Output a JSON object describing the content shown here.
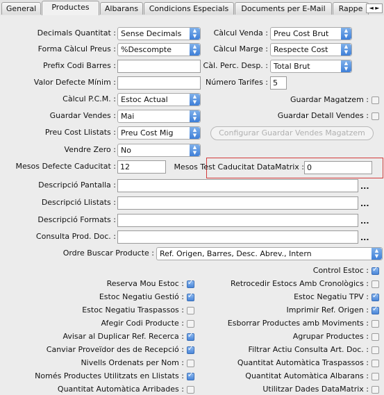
{
  "tabs": [
    "General",
    "Productes",
    "Albarans",
    "Condicions Especials",
    "Documents per E-Mail",
    "Rappe"
  ],
  "tab_scroll_arrows": "◄ ►",
  "form": {
    "decimals_quantitat": {
      "label": "Decimals Quantitat :",
      "value": "Sense Decimals"
    },
    "forma_calcul_preus": {
      "label": "Forma Càlcul Preus :",
      "value": "%Descompte"
    },
    "prefix_codi_barres": {
      "label": "Prefix Codi Barres :",
      "value": ""
    },
    "valor_defecte_minim": {
      "label": "Valor Defecte Mínim :",
      "value": ""
    },
    "calcul_pcm": {
      "label": "Càlcul P.C.M. :",
      "value": "Estoc Actual"
    },
    "guardar_vendes": {
      "label": "Guardar Vendes :",
      "value": "Mai"
    },
    "preu_cost_llistats": {
      "label": "Preu Cost Llistats :",
      "value": "Preu Cost Mig"
    },
    "vendre_zero": {
      "label": "Vendre Zero :",
      "value": "No"
    },
    "mesos_defecte_caducitat": {
      "label": "Mesos Defecte Caducitat :",
      "value": "12"
    },
    "calcul_venda": {
      "label": "Càlcul Venda :",
      "value": "Preu Cost Brut"
    },
    "calcul_marge": {
      "label": "Càlcul Marge :",
      "value": "Respecte Cost"
    },
    "cal_perc_desp": {
      "label": "Càl. Perc. Desp. :",
      "value": "Total Brut"
    },
    "numero_tarifes": {
      "label": "Número Tarifes :",
      "value": "5"
    },
    "guardar_magatzem": {
      "label": "Guardar Magatzem :",
      "checked": false
    },
    "guardar_detall_vendes": {
      "label": "Guardar Detall Vendes :",
      "checked": false
    },
    "configurar_button": "Configurar Guardar Vendes Magatzem",
    "mesos_test_caducitat": {
      "label": "Mesos Test Caducitat DataMatrix :",
      "value": "0"
    },
    "descripcio_pantalla": {
      "label": "Descripció Pantalla :",
      "value": ""
    },
    "descripcio_llistats": {
      "label": "Descripció Llistats :",
      "value": ""
    },
    "descripcio_formats": {
      "label": "Descripció Formats :",
      "value": ""
    },
    "consulta_prod_doc": {
      "label": "Consulta Prod. Doc. :",
      "value": ""
    },
    "ellipsis": "...",
    "ordre_buscar": {
      "label": "Ordre Buscar Producte :",
      "value": "Ref. Origen, Barres, Desc. Abrev., Intern"
    }
  },
  "checks_left": [
    {
      "label": "Reserva Mou Estoc :",
      "checked": true
    },
    {
      "label": "Estoc Negatiu Gestió :",
      "checked": true
    },
    {
      "label": "Estoc Negatiu Traspassos :",
      "checked": false
    },
    {
      "label": "Afegir Codi Producte :",
      "checked": false
    },
    {
      "label": "Avisar al Duplicar Ref. Recerca :",
      "checked": true
    },
    {
      "label": "Canviar Proveïdor des de Recepció :",
      "checked": true
    },
    {
      "label": "Nivells Ordenats per Nom :",
      "checked": false
    },
    {
      "label": "Només Productes Utilitzats en Llistats :",
      "checked": true
    },
    {
      "label": "Quantitat Automàtica Arribades :",
      "checked": false
    }
  ],
  "checks_right": [
    {
      "label": "Control Estoc :",
      "checked": true
    },
    {
      "label": "Retrocedir Estocs Amb Cronològics :",
      "checked": false
    },
    {
      "label": "Estoc Negatiu TPV :",
      "checked": true
    },
    {
      "label": "Imprimir Ref. Origen :",
      "checked": true
    },
    {
      "label": "Esborrar Productes amb Moviments :",
      "checked": false
    },
    {
      "label": "Agrupar Productes :",
      "checked": false
    },
    {
      "label": "Filtrar Actiu Consulta Art. Doc. :",
      "checked": false
    },
    {
      "label": "Quantitat Automàtica Traspassos :",
      "checked": false
    },
    {
      "label": "Quantitat Automàtica Albarans :",
      "checked": false
    },
    {
      "label": "Utilitzar Dades DataMatrix :",
      "checked": false
    }
  ]
}
